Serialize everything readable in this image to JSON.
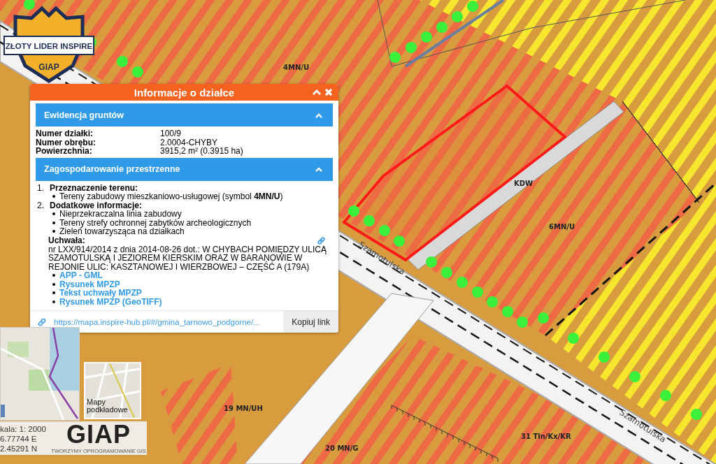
{
  "badge": {
    "title": "ZŁOTY LIDER INSPIRE",
    "subtitle": "GIAP"
  },
  "map_labels": [
    {
      "kind": "zone",
      "text": "4MN/U"
    },
    {
      "kind": "zone",
      "text": "KDW"
    },
    {
      "kind": "zone",
      "text": "6MN/U"
    },
    {
      "kind": "street",
      "text": "Szamotulska"
    },
    {
      "kind": "zone",
      "text": "19 MN/UH"
    },
    {
      "kind": "zone",
      "text": "20 MN/G"
    },
    {
      "kind": "zone",
      "text": "31 Tln/Kx/KR"
    },
    {
      "kind": "street",
      "text": "Szamotulska"
    }
  ],
  "popup": {
    "title": "Informacje o działce",
    "sections": [
      {
        "kind": "fields",
        "title": "Ewidencja gruntów",
        "expanded": true,
        "fields": [
          {
            "label": "Numer działki:",
            "value": "100/9"
          },
          {
            "label": "Numer obrębu:",
            "value": "2.0004-CHYBY"
          },
          {
            "label": "Powierzchnia:",
            "value": "3915,2 m² (0.3915 ha)"
          }
        ]
      },
      {
        "kind": "plan",
        "title": "Zagospodarowanie przestrzenne",
        "expanded": true,
        "items": [
          {
            "number": "1.",
            "title": "Przeznaczenie terenu:",
            "bullets": [
              "Tereny zabudowy mieszkaniowo-usługowej (symbol **4MN/U**)"
            ]
          },
          {
            "number": "2.",
            "title": "Dodatkowe informacje:",
            "bullets": [
              "Nieprzekraczalna linia zabudowy",
              "Tereny strefy ochronnej zabytków archeologicznych",
              "Zieleń towarzysząca na działkach"
            ]
          }
        ],
        "resolution": {
          "label": "Uchwała:",
          "text": "nr LXX/914/2014 z dnia 2014-08-26 dot.: W CHYBACH POMIĘDZY ULICĄ SZAMOTULSKĄ I JEZIOREM KIERSKIM ORAZ W BARANOWIE W REJONIE ULIC: KASZTANOWEJ I WIERZBOWEJ – CZĘŚĆ A (179A)",
          "links": [
            "APP - GML",
            "Rysunek MPZP",
            "Tekst uchwały MPZP",
            "Rysunek MPZP (GeoTIFF)"
          ]
        }
      }
    ],
    "url": "https://mapa.inspire-hub.pl/#/gmina_tarnowo_podgorne/...",
    "copy_button": "Kopiuj link"
  },
  "basemap_tile": {
    "label": "Mapy podkładowe"
  },
  "scale_info": [
    "kala: 1: 2000",
    "6.77744 E",
    "2.45291 N"
  ],
  "logo": {
    "name": "GIAP",
    "tagline": "TWORZYMY OPROGRAMOWANIE GIS"
  }
}
